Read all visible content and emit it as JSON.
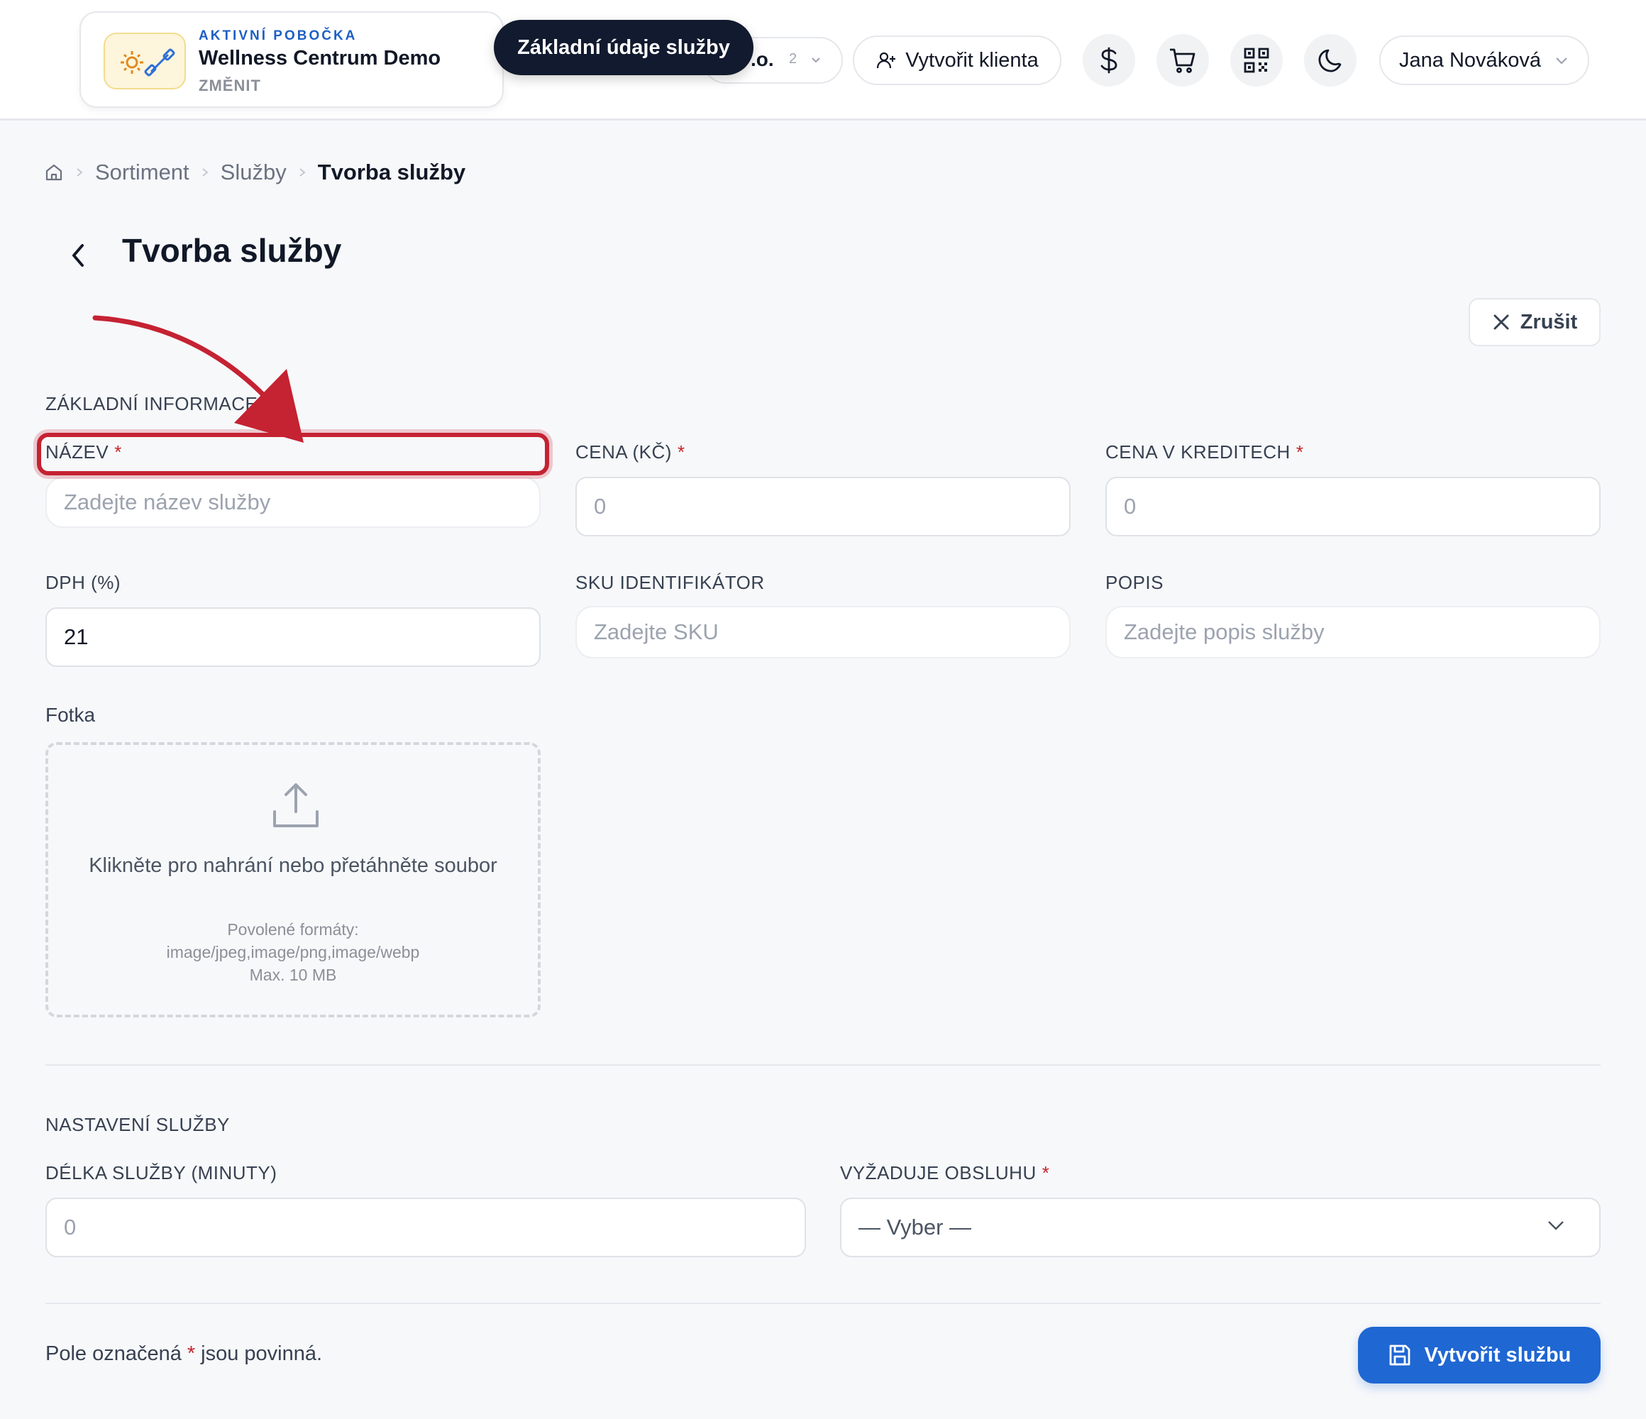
{
  "header": {
    "branch": {
      "eyebrow": "AKTIVNÍ POBOČKA",
      "name": "Wellness Centrum Demo",
      "change": "ZMĚNIT"
    },
    "company": {
      "name": ".o.",
      "count": "2"
    },
    "tooltip": "Základní údaje služby",
    "create_client": "Vytvořit klienta",
    "icons": [
      "dollar-icon",
      "cart-icon",
      "qr-code-icon",
      "moon-icon"
    ],
    "user": "Jana Nováková"
  },
  "breadcrumb": {
    "items": [
      "Sortiment",
      "Služby"
    ],
    "current": "Tvorba služby"
  },
  "page": {
    "title": "Tvorba služby",
    "cancel": "Zrušit"
  },
  "basic": {
    "heading": "ZÁKLADNÍ INFORMACE",
    "name": {
      "label": "NÁZEV",
      "required": "*",
      "placeholder": "Zadejte název služby"
    },
    "price": {
      "label": "CENA (KČ)",
      "required": "*",
      "placeholder": "0"
    },
    "credits": {
      "label": "CENA V KREDITECH",
      "required": "*",
      "placeholder": "0"
    },
    "vat": {
      "label": "DPH (%)",
      "value": "21"
    },
    "sku": {
      "label": "SKU IDENTIFIKÁTOR",
      "placeholder": "Zadejte SKU"
    },
    "description": {
      "label": "POPIS",
      "placeholder": "Zadejte popis služby"
    },
    "photo": {
      "label": "Fotka",
      "main": "Klikněte pro nahrání nebo přetáhněte soubor",
      "formats_label": "Povolené formáty:",
      "formats": "image/jpeg,image/png,image/webp",
      "max": "Max. 10 MB"
    }
  },
  "settings": {
    "heading": "NASTAVENÍ SLUŽBY",
    "duration": {
      "label": "DÉLKA SLUŽBY (MINUTY)",
      "placeholder": "0"
    },
    "staff": {
      "label": "VYŽADUJE OBSLUHU",
      "required": "*",
      "selected": "— Vyber —"
    }
  },
  "footer": {
    "note_before": "Pole označená",
    "note_star": "*",
    "note_after": "jsou povinná.",
    "submit": "Vytvořit službu"
  },
  "annotation": {
    "color": "#c52232"
  },
  "colors": {
    "primary": "#1f67d2",
    "required": "#c4242c",
    "tooltip_bg": "#111a2e",
    "eyebrow": "#1d5fc4"
  }
}
